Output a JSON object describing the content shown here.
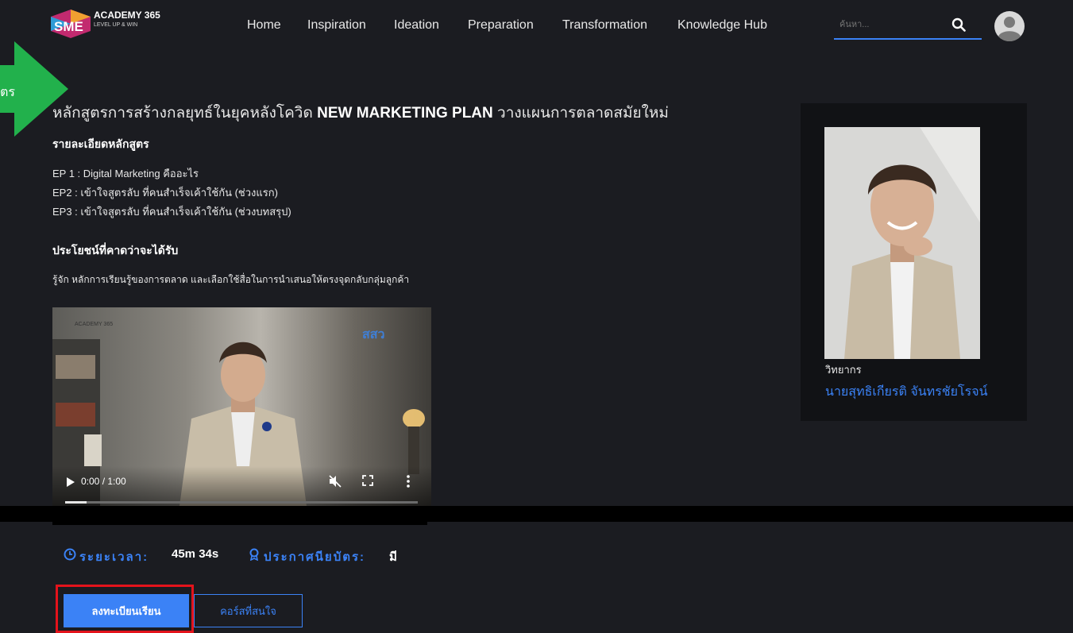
{
  "header": {
    "logo_mark": "SME",
    "logo_title": "ACADEMY 365",
    "logo_subtitle": "LEVEL UP & WIN",
    "nav": [
      "Home",
      "Inspiration",
      "Ideation",
      "Preparation",
      "Transformation",
      "Knowledge Hub"
    ],
    "search_placeholder": "ค้นหา...",
    "icons": {
      "search": "search-icon",
      "avatar": "user-avatar-icon"
    }
  },
  "overlay": {
    "arrow_text": "ตร",
    "arrow_color": "#22b14c"
  },
  "course": {
    "title_pre": "หลักสูตรการสร้างกลยุทธ์ในยุคหลังโควิด ",
    "title_bold": "NEW MARKETING PLAN",
    "title_post": " วางแผนการตลาดสมัยใหม่",
    "details_heading": "รายละเอียดหลักสูตร",
    "episodes": [
      "EP 1 : Digital Marketing คืออะไร",
      "EP2 : เข้าใจสูตรลับ ที่คนสำเร็จเค้าใช้กัน (ช่วงแรก)",
      "EP3 : เข้าใจสูตรลับ ที่คนสำเร็จเค้าใช้กัน (ช่วงบทสรุป)"
    ],
    "benefits_heading": "ประโยชน์ที่คาดว่าจะได้รับ",
    "benefits_text": "รู้จัก หลักการเรียนรู้ของการตลาด และเลือกใช้สื่อในการนำเสนอให้ตรงจุดกลับกลุ่มลูกค้า"
  },
  "video": {
    "time": "0:00 / 1:00",
    "progress": 0.06,
    "watermark_logo": "ACADEMY 365",
    "watermark_brand": "สสว"
  },
  "meta": {
    "duration_label": "ระยะเวลา:",
    "duration_value": "45m 34s",
    "certificate_label": "ประกาศนียบัตร:",
    "certificate_value": "มี"
  },
  "buttons": {
    "enroll": "ลงทะเบียนเรียน",
    "interested": "คอร์สที่สนใจ"
  },
  "instructor": {
    "label": "วิทยากร",
    "name": "นายสุทธิเกียรติ จันทรชัยโรจน์"
  },
  "colors": {
    "accent": "#3b82f6",
    "highlight_box": "#e4131b",
    "background": "#1b1c21"
  }
}
